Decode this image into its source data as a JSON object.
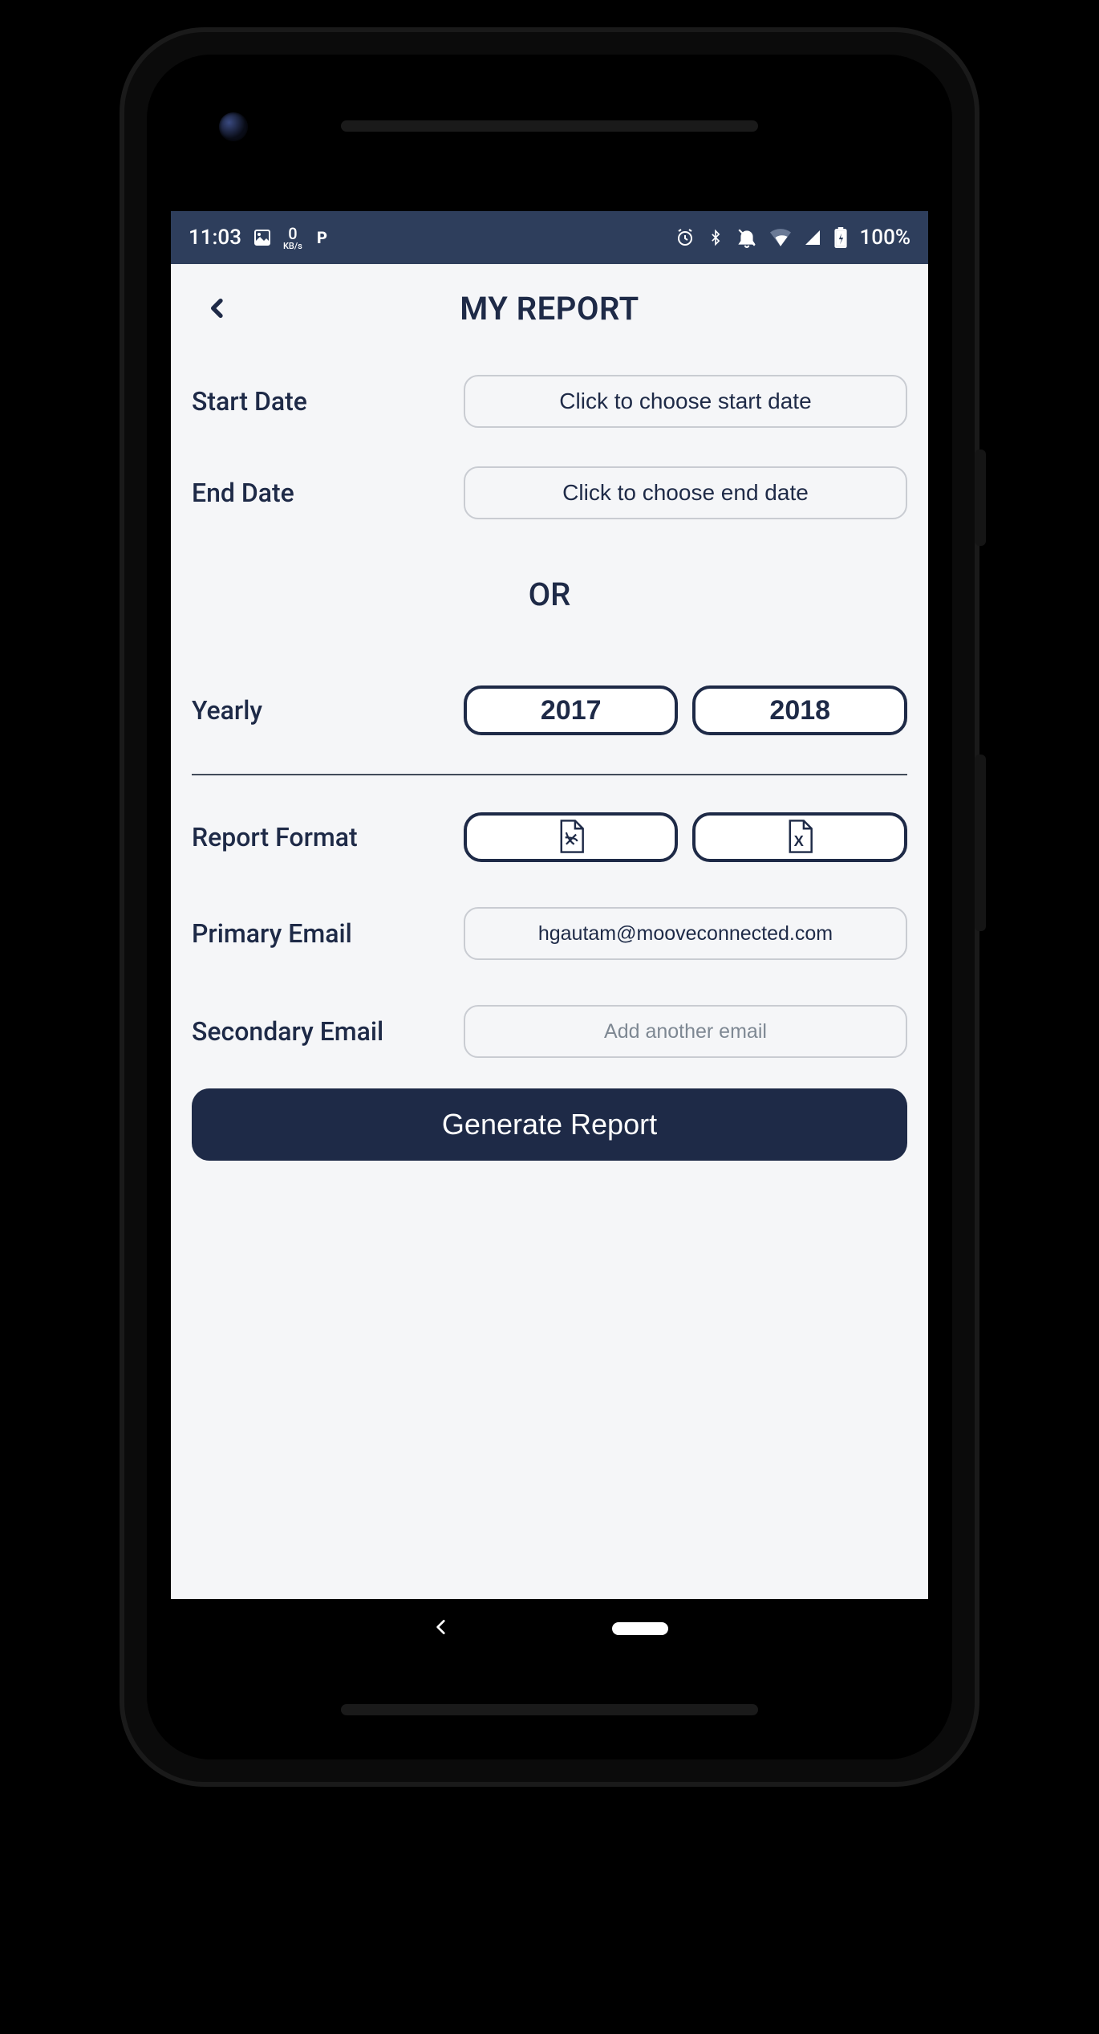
{
  "statusbar": {
    "time": "11:03",
    "kb_rate": "0",
    "kb_unit": "KB/s",
    "battery": "100%"
  },
  "header": {
    "title": "MY REPORT"
  },
  "form": {
    "start_date": {
      "label": "Start Date",
      "button": "Click to choose start date"
    },
    "end_date": {
      "label": "End Date",
      "button": "Click to choose end date"
    },
    "or_text": "OR",
    "yearly": {
      "label": "Yearly",
      "options": [
        "2017",
        "2018"
      ]
    },
    "report_format": {
      "label": "Report Format",
      "options": [
        "pdf",
        "xls"
      ]
    },
    "primary_email": {
      "label": "Primary Email",
      "value": "hgautam@mooveconnected.com"
    },
    "secondary_email": {
      "label": "Secondary Email",
      "placeholder": "Add another email"
    },
    "generate_label": "Generate Report"
  },
  "icons": {
    "back": "back-chevron",
    "image": "image-icon",
    "p": "p-icon",
    "alarm": "alarm-icon",
    "bluetooth": "bluetooth-icon",
    "mute": "bell-off-icon",
    "wifi": "wifi-icon",
    "signal": "signal-icon",
    "battery": "battery-charging-icon",
    "pdf": "pdf-file-icon",
    "xls": "xls-file-icon"
  }
}
